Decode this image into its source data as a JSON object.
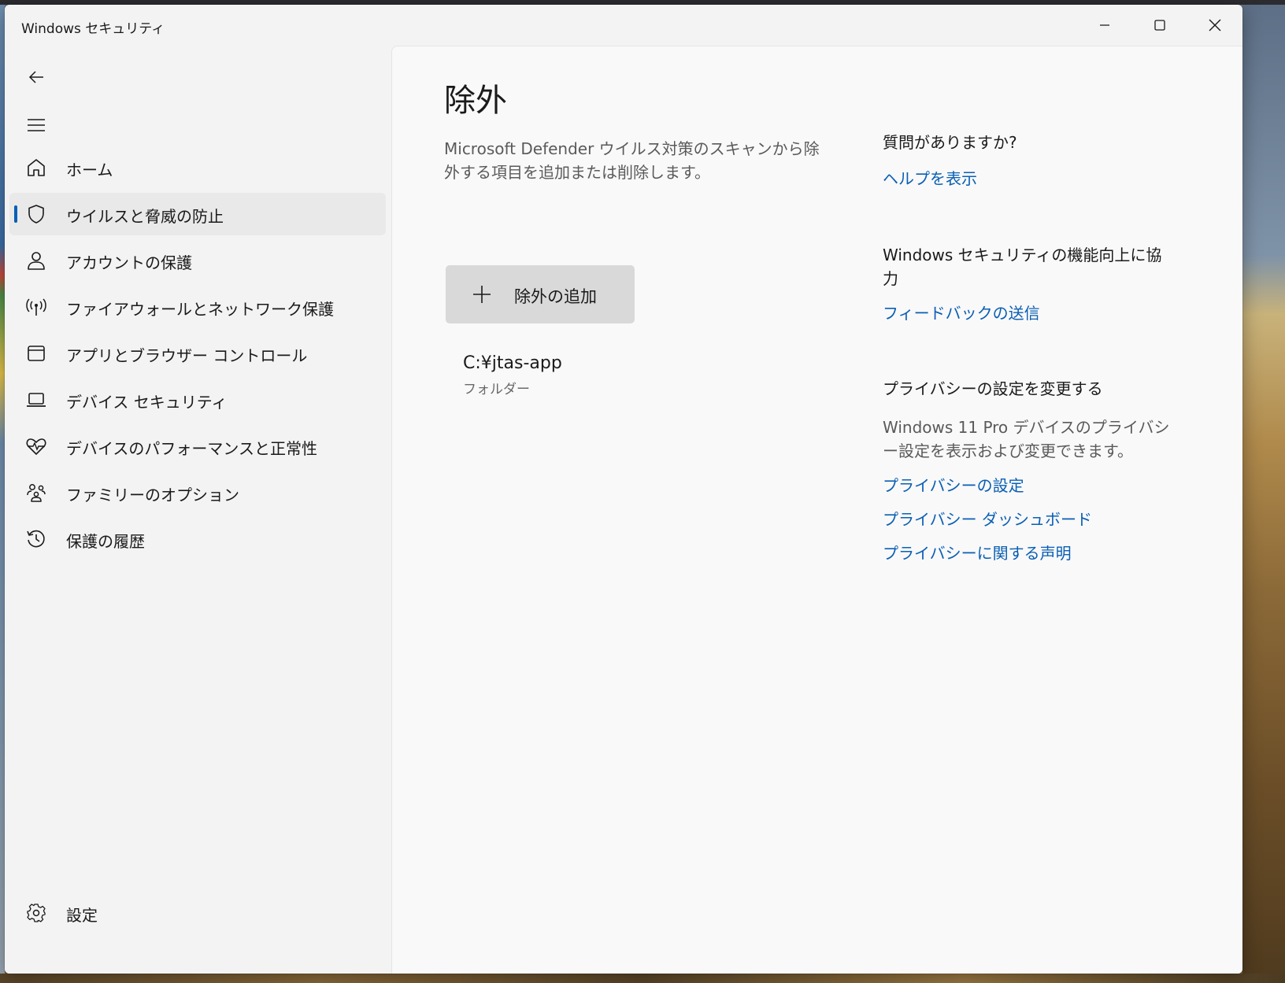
{
  "window": {
    "title": "Windows セキュリティ"
  },
  "sidebar": {
    "items": [
      {
        "label": "ホーム",
        "icon": "home-icon"
      },
      {
        "label": "ウイルスと脅威の防止",
        "icon": "shield-icon",
        "selected": true
      },
      {
        "label": "アカウントの保護",
        "icon": "person-icon"
      },
      {
        "label": "ファイアウォールとネットワーク保護",
        "icon": "broadcast-icon"
      },
      {
        "label": "アプリとブラウザー コントロール",
        "icon": "app-window-icon"
      },
      {
        "label": "デバイス セキュリティ",
        "icon": "laptop-icon"
      },
      {
        "label": "デバイスのパフォーマンスと正常性",
        "icon": "heart-pulse-icon"
      },
      {
        "label": "ファミリーのオプション",
        "icon": "family-icon"
      },
      {
        "label": "保護の履歴",
        "icon": "history-icon"
      }
    ],
    "settings_label": "設定"
  },
  "main": {
    "title": "除外",
    "description": "Microsoft Defender ウイルス対策のスキャンから除外する項目を追加または削除します。",
    "add_button_label": "除外の追加",
    "exclusions": [
      {
        "path": "C:¥jtas-app",
        "type": "フォルダー"
      }
    ]
  },
  "right_panel": {
    "help_heading": "質問がありますか?",
    "help_link": "ヘルプを表示",
    "feedback_heading": "Windows セキュリティの機能向上に協力",
    "feedback_link": "フィードバックの送信",
    "privacy_heading": "プライバシーの設定を変更する",
    "privacy_text": "Windows 11 Pro デバイスのプライバシー設定を表示および変更できます。",
    "privacy_links": [
      "プライバシーの設定",
      "プライバシー ダッシュボード",
      "プライバシーに関する声明"
    ]
  },
  "colors": {
    "accent": "#005fb8",
    "link": "#0a5fb4"
  }
}
